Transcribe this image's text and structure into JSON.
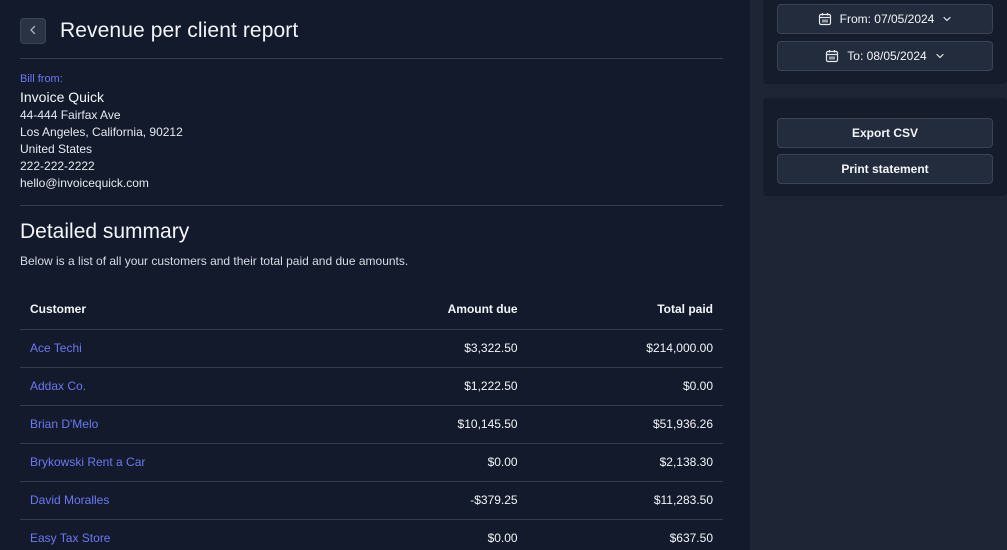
{
  "header": {
    "title": "Revenue per client report"
  },
  "bill_from": {
    "label": "Bill from:",
    "company": "Invoice Quick",
    "address1": "44-444 Fairfax Ave",
    "address2": "Los Angeles, California, 90212",
    "country": "United States",
    "phone": "222-222-2222",
    "email": "hello@invoicequick.com"
  },
  "summary": {
    "title": "Detailed summary",
    "description": "Below is a list of all your customers and their total paid and due amounts."
  },
  "table": {
    "columns": [
      "Customer",
      "Amount due",
      "Total paid"
    ],
    "rows": [
      {
        "customer": "Ace Techi",
        "amount_due": "$3,322.50",
        "total_paid": "$214,000.00"
      },
      {
        "customer": "Addax Co.",
        "amount_due": "$1,222.50",
        "total_paid": "$0.00"
      },
      {
        "customer": "Brian D'Melo",
        "amount_due": "$10,145.50",
        "total_paid": "$51,936.26"
      },
      {
        "customer": "Brykowski Rent a Car",
        "amount_due": "$0.00",
        "total_paid": "$2,138.30"
      },
      {
        "customer": "David Moralles",
        "amount_due": "-$379.25",
        "total_paid": "$11,283.50"
      },
      {
        "customer": "Easy Tax Store",
        "amount_due": "$0.00",
        "total_paid": "$637.50"
      }
    ]
  },
  "sidebar": {
    "from_date": "From: 07/05/2024",
    "to_date": "To: 08/05/2024",
    "export_label": "Export CSV",
    "print_label": "Print statement"
  },
  "colors": {
    "background": "#121a2b",
    "sidebar": "#1e2636",
    "link": "#6c78f4",
    "divider": "#343d4f"
  }
}
